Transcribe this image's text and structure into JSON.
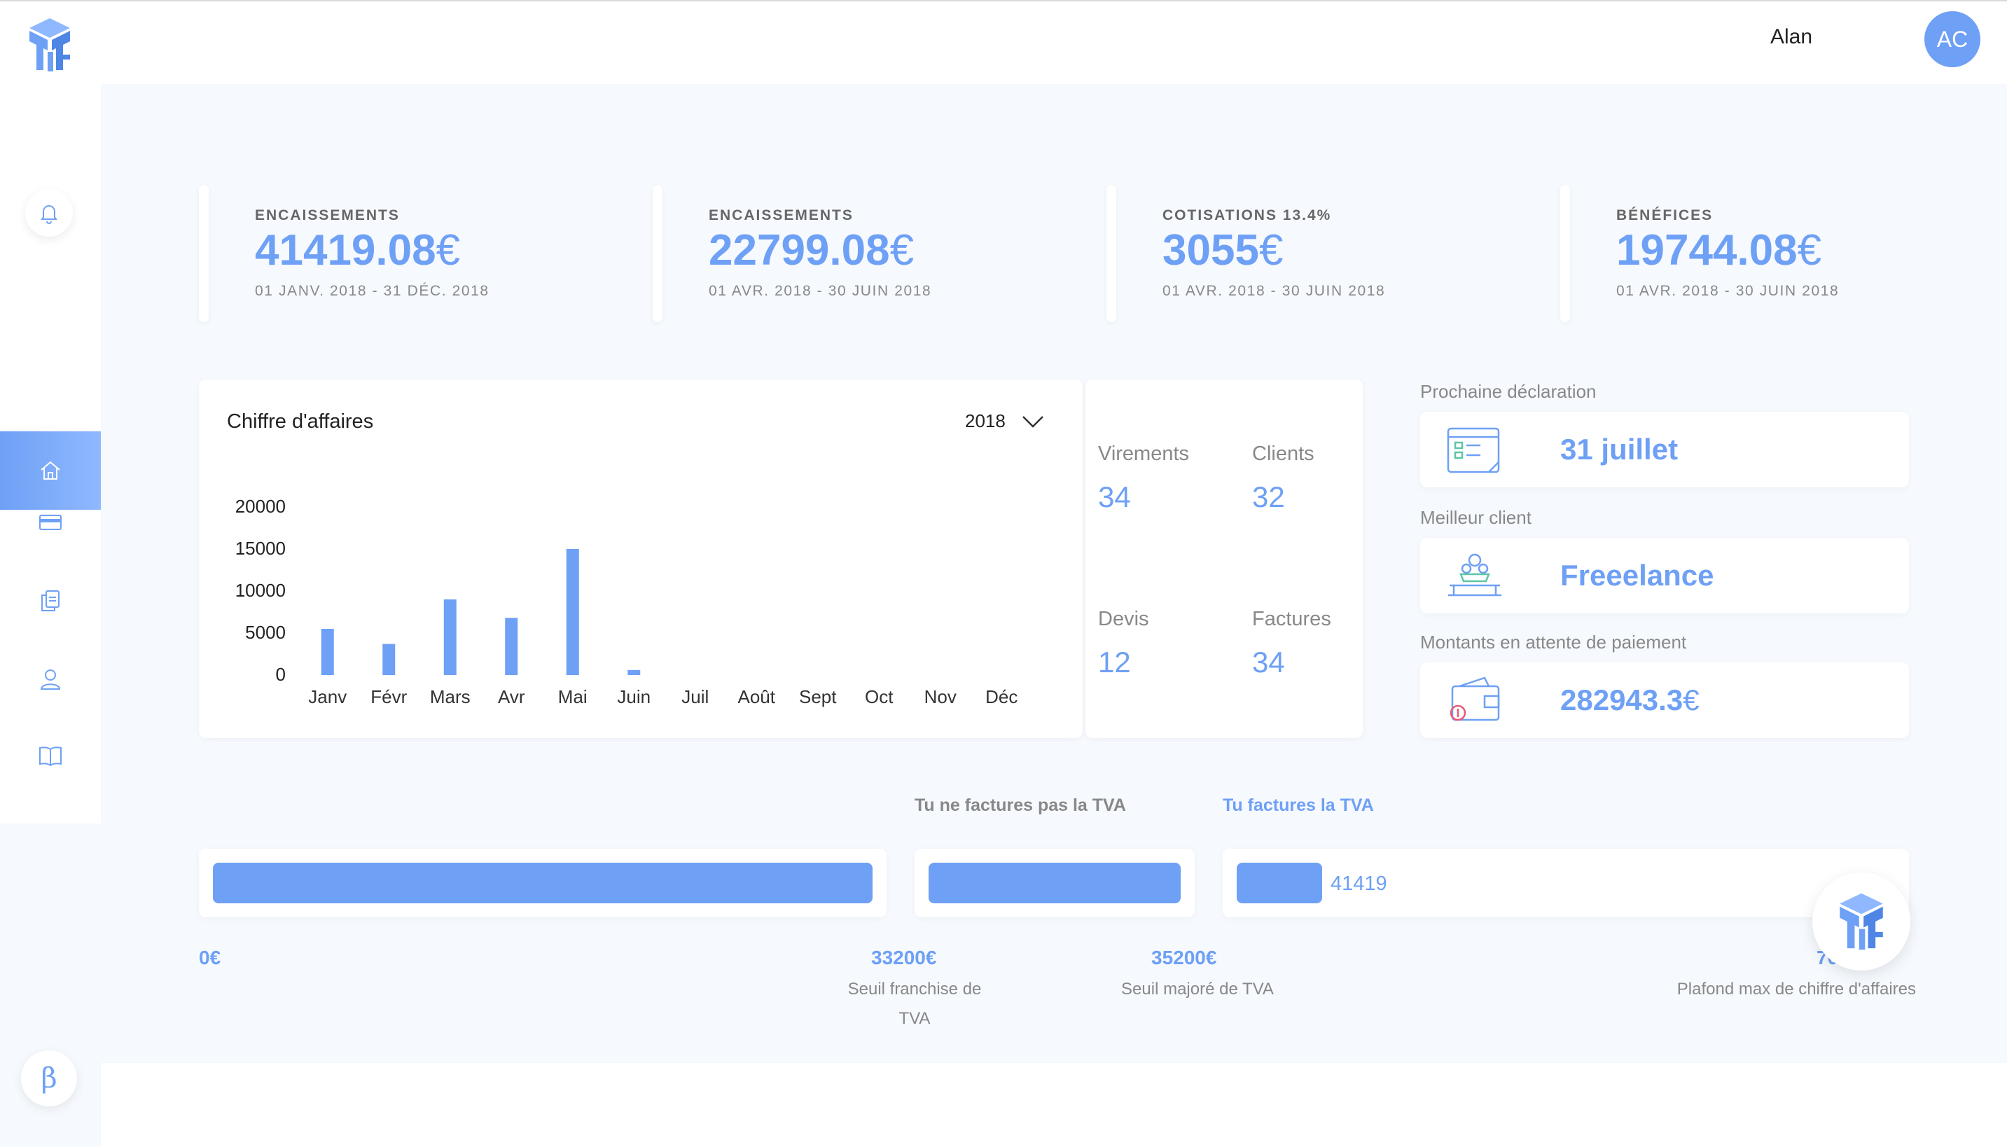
{
  "header": {
    "user_name": "Alan",
    "avatar_initials": "AC"
  },
  "colors": {
    "accent": "#6ea0f5",
    "background": "#f6f9fe"
  },
  "sidebar": {
    "items": [
      {
        "icon": "bell-icon",
        "active": false
      },
      {
        "icon": "home-icon",
        "active": true
      },
      {
        "icon": "credit-card-icon",
        "active": false
      },
      {
        "icon": "documents-icon",
        "active": false
      },
      {
        "icon": "user-icon",
        "active": false
      },
      {
        "icon": "book-icon",
        "active": false
      }
    ],
    "beta_label": "β"
  },
  "stats": [
    {
      "label": "ENCAISSEMENTS",
      "value": "41419.08",
      "currency": "€",
      "range": "01 JANV. 2018 - 31 DÉC. 2018"
    },
    {
      "label": "ENCAISSEMENTS",
      "value": "22799.08",
      "currency": "€",
      "range": "01 AVR. 2018 - 30 JUIN 2018"
    },
    {
      "label": "COTISATIONS 13.4%",
      "value": "3055",
      "currency": "€",
      "range": "01 AVR. 2018 - 30 JUIN 2018"
    },
    {
      "label": "BÉNÉFICES",
      "value": "19744.08",
      "currency": "€",
      "range": "01 AVR. 2018 - 30 JUIN 2018"
    }
  ],
  "chart_card": {
    "title": "Chiffre d'affaires",
    "year": "2018"
  },
  "chart_data": {
    "type": "bar",
    "title": "Chiffre d'affaires",
    "categories": [
      "Janv",
      "Févr",
      "Mars",
      "Avr",
      "Mai",
      "Juin",
      "Juil",
      "Août",
      "Sept",
      "Oct",
      "Nov",
      "Déc"
    ],
    "values": [
      5500,
      3700,
      9000,
      6800,
      15000,
      600,
      0,
      0,
      0,
      0,
      0,
      0
    ],
    "yticks": [
      "0",
      "5000",
      "10000",
      "15000",
      "20000"
    ],
    "ylim": [
      0,
      20000
    ],
    "grid": false,
    "color": "#6ea0f5"
  },
  "kpis": {
    "virements": {
      "label": "Virements",
      "value": "34"
    },
    "clients": {
      "label": "Clients",
      "value": "32"
    },
    "devis": {
      "label": "Devis",
      "value": "12"
    },
    "factures": {
      "label": "Factures",
      "value": "34"
    }
  },
  "side": {
    "next_declaration": {
      "label": "Prochaine déclaration",
      "value": "31 juillet",
      "icon": "calendar-icon"
    },
    "best_client": {
      "label": "Meilleur client",
      "value": "Freeelance",
      "icon": "podium-icon"
    },
    "pending": {
      "label": "Montants en attente de paiement",
      "value": "282943.3",
      "currency": "€",
      "icon": "wallet-icon"
    }
  },
  "tva": {
    "no_tva_caption": "Tu ne factures pas la TVA",
    "tva_caption": "Tu factures la TVA",
    "current_value": "41419",
    "current_fraction": 0.13,
    "marks": [
      {
        "value": "0€",
        "label": ""
      },
      {
        "value": "33200€",
        "label": "Seuil franchise de TVA"
      },
      {
        "value": "35200€",
        "label": "Seuil majoré de TVA"
      },
      {
        "value": "70000€",
        "label": "Plafond max de chiffre d'affaires"
      }
    ]
  }
}
